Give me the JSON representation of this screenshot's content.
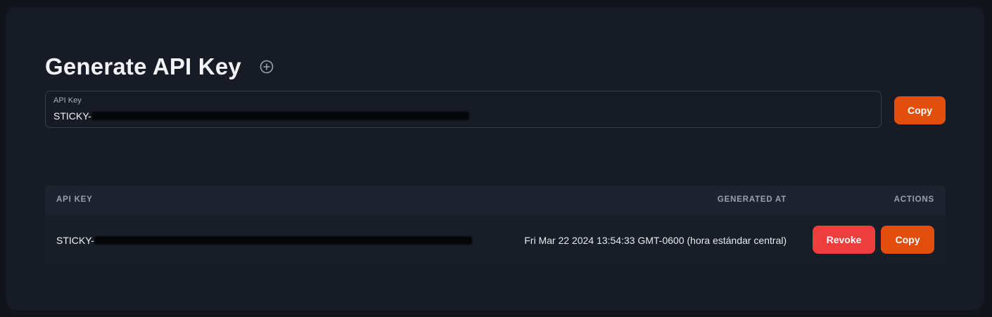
{
  "page": {
    "title": "Generate API Key",
    "add_icon": "plus-circle-icon"
  },
  "key_field": {
    "label": "API Key",
    "value_prefix": "STICKY-",
    "value_redacted": true
  },
  "top_copy_button": {
    "label": "Copy"
  },
  "table": {
    "headers": {
      "api_key": "API KEY",
      "generated_at": "GENERATED AT",
      "actions": "ACTIONS"
    },
    "rows": [
      {
        "api_key_prefix": "STICKY-",
        "api_key_redacted": true,
        "generated_at": "Fri Mar 22 2024 13:54:33 GMT-0600 (hora estándar central)",
        "revoke_label": "Revoke",
        "copy_label": "Copy"
      }
    ]
  },
  "colors": {
    "background": "#11141b",
    "card": "#161b25",
    "copy_button": "#e24f0c",
    "revoke_button": "#ee3d3d"
  }
}
